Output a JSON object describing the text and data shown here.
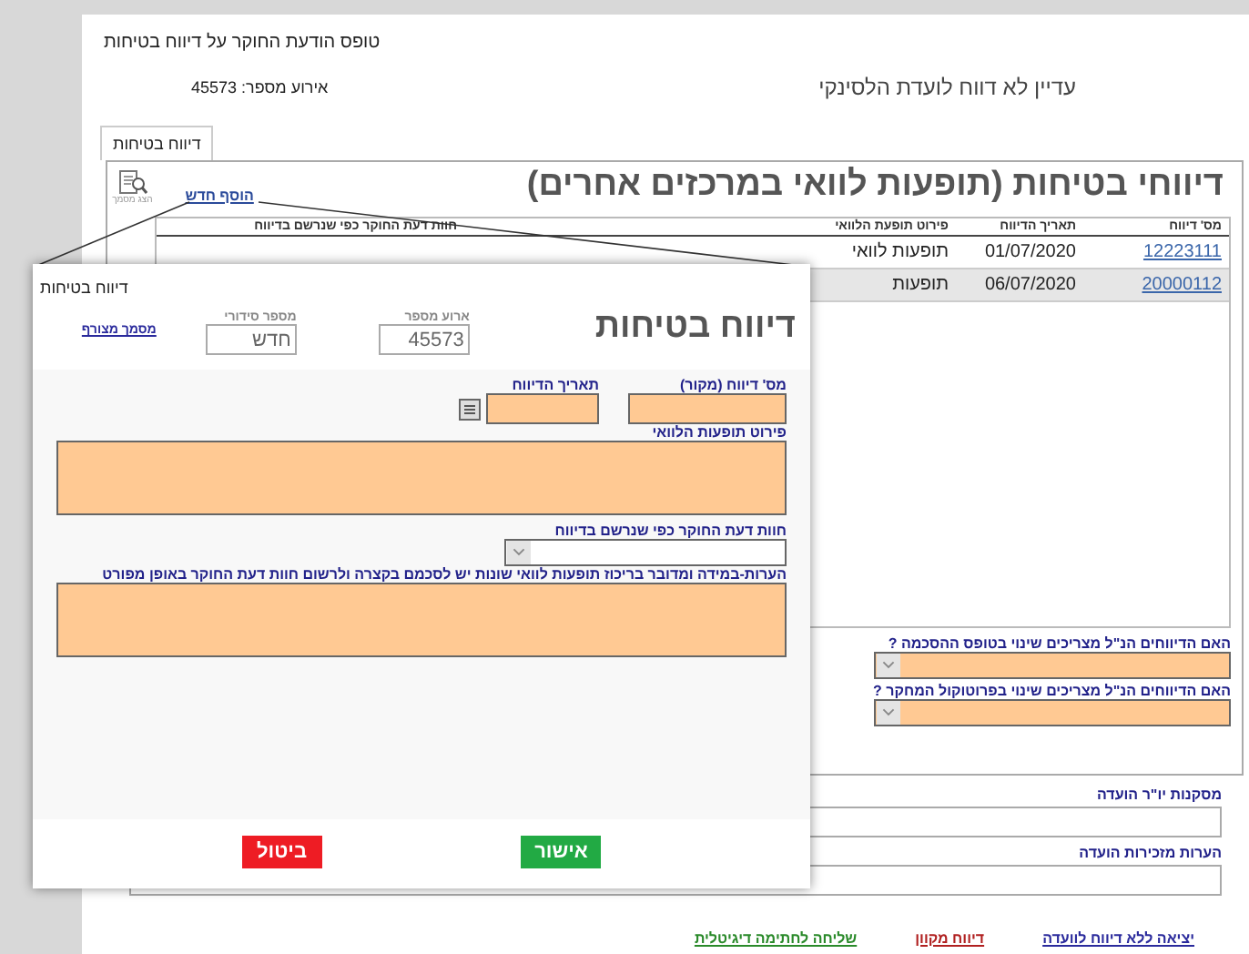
{
  "form_title": "טופס הודעת החוקר על דיווח בטיחות",
  "event": "אירוע מספר: 45573",
  "status": "עדיין לא דווח לועדת הלסינקי",
  "tabs": [
    {
      "label": "דיווח בטיחות",
      "selected": true
    }
  ],
  "section": {
    "heading": "דיווחי בטיחות (תופעות לוואי במרכזים אחרים)",
    "add_link": "הוסף חדש",
    "view_doc": "הצג מסמך"
  },
  "table": {
    "columns": [
      "מס' דיווח",
      "תאריך הדיווח",
      "פירוט תופעת הלוואי",
      "חוות דעת החוקר כפי שנרשם בדיווח"
    ],
    "rows": [
      {
        "cells": [
          "12223111",
          "01/07/2020",
          "תופעות לוואי"
        ],
        "selected": false
      },
      {
        "cells": [
          "20000112",
          "06/07/2020",
          "תופעות"
        ],
        "selected": true
      }
    ]
  },
  "questions": [
    {
      "label": "האם הדיווחים הנ\"ל מצריכים שינוי בטופס ההסכמה ?"
    },
    {
      "label": "האם הדיווחים הנ\"ל מצריכים שינוי בפרוטוקול המחקר ?"
    }
  ],
  "committee_fields": [
    {
      "label": "מסקנות יו\"ר הועדה"
    },
    {
      "label": "הערות מזכירות הועדה"
    }
  ],
  "footer_links": [
    {
      "label": "יציאה ללא דיווח לוועדה",
      "color": "#2a2a9c"
    },
    {
      "label": "דיווח מקוון",
      "color": "#b02020"
    },
    {
      "label": "שליחה לחתימה דיגיטלית",
      "color": "#2a8a2a"
    }
  ],
  "dialog": {
    "title": "דיווח בטיחות",
    "heading": "דיווח בטיחות",
    "event_field": {
      "label": "ארוע מספר",
      "value": "45573"
    },
    "serial_field": {
      "label": "מספר סידורי",
      "value": "חדש"
    },
    "attachment_link": "מסמך מצורף",
    "fields": [
      {
        "label": "מס' דיווח (מקור)",
        "kind": "text"
      },
      {
        "label": "תאריך הדיווח",
        "kind": "date"
      },
      {
        "label": "פירוט תופעות הלוואי",
        "kind": "textarea"
      },
      {
        "label": "חוות דעת החוקר כפי שנרשם בדיווח",
        "kind": "select"
      },
      {
        "label": "הערות-במידה ומדובר בריכוז תופעות לוואי שונות יש לסכמם בקצרה ולרשום חוות דעת החוקר באופן מפורט",
        "kind": "textarea"
      }
    ],
    "buttons": [
      {
        "label": "אישור",
        "kind": "confirm"
      },
      {
        "label": "ביטול",
        "kind": "cancel"
      }
    ]
  }
}
